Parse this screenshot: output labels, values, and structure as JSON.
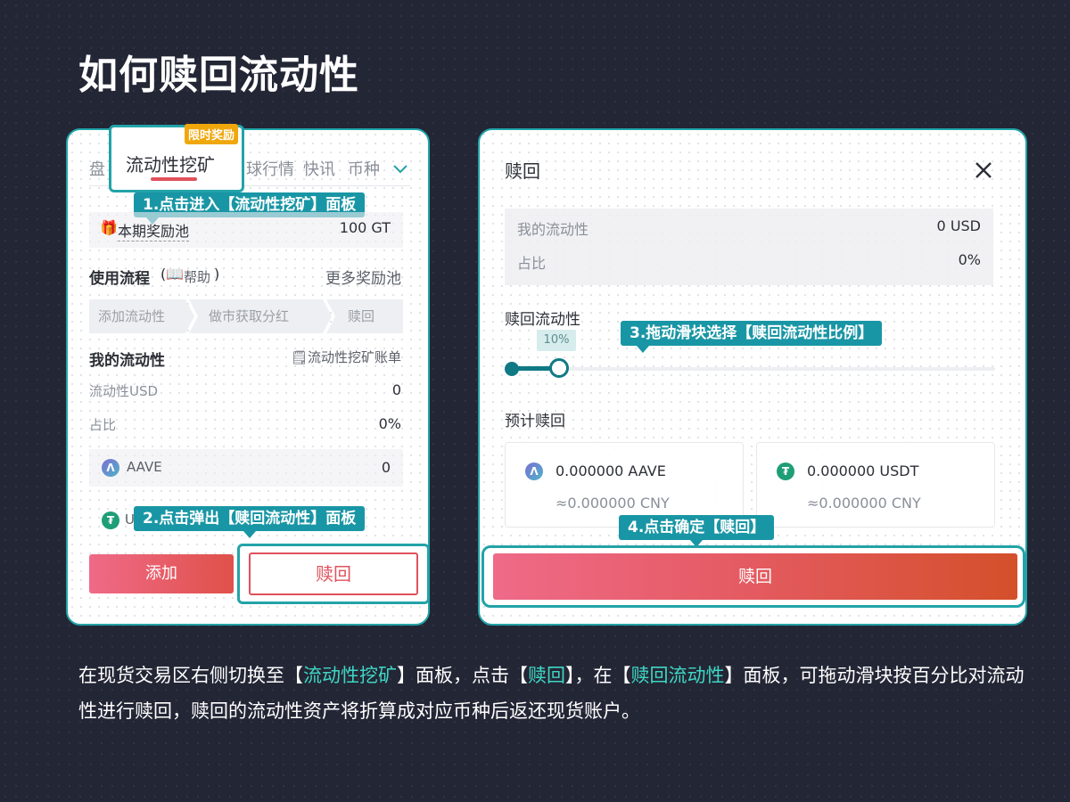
{
  "page": {
    "title": "如何赎回流动性"
  },
  "left": {
    "tabs": [
      "盘",
      "流动性挖矿",
      "球行情",
      "快讯",
      "币种"
    ],
    "reward_badge": "限时奖励",
    "pool_label": "本期奖励池",
    "pool_value": "100 GT",
    "process_title": "使用流程",
    "help_label": "帮助",
    "more_pools": "更多奖励池",
    "steps": [
      "添加流动性",
      "做市获取分红",
      "赎回"
    ],
    "my_liquidity_title": "我的流动性",
    "bill_link": "流动性挖矿账单",
    "liq_usd_label": "流动性USD",
    "liq_usd_value": "0",
    "ratio_label": "占比",
    "ratio_value": "0%",
    "aave_label": "AAVE",
    "aave_value": "0",
    "usdt_partial": "U",
    "add_button": "添加",
    "redeem_button": "赎回"
  },
  "right": {
    "title": "赎回",
    "my_liquidity_label": "我的流动性",
    "my_liquidity_value": "0 USD",
    "ratio_label": "占比",
    "ratio_value": "0%",
    "redeem_liquidity_label": "赎回流动性",
    "slider_percent": "10%",
    "slider_value": 10,
    "estimate_label": "预计赎回",
    "aave_amount": "0.000000 AAVE",
    "aave_cny": "≈0.000000 CNY",
    "usdt_amount": "0.000000 USDT",
    "usdt_cny": "≈0.000000 CNY",
    "confirm_button": "赎回"
  },
  "callouts": {
    "step1": "1.点击进入【流动性挖矿】面板",
    "step2": "2.点击弹出【赎回流动性】面板",
    "step3": "3.拖动滑块选择【赎回流动性比例】",
    "step4": "4.点击确定【赎回】"
  },
  "description": {
    "p1": "在现货交易区右侧切换至【",
    "h1": "流动性挖矿",
    "p2": "】面板，点击【",
    "h2": "赎回",
    "p3": "】，在【",
    "h3": "赎回流动性",
    "p4": "】面板，可拖动滑块按百分比对流动性进行赎回，赎回的流动性资产将折算成对应币种后返还现货账户。"
  },
  "colors": {
    "accent": "#22a3a8",
    "callout": "#1996a5",
    "highlight": "#3fd7c4",
    "danger": "#e0515c"
  }
}
